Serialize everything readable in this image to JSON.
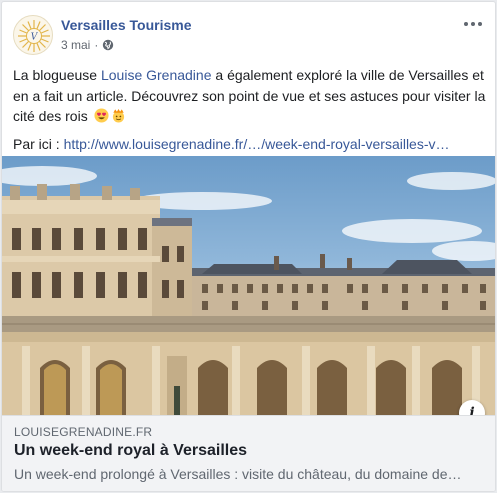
{
  "post": {
    "page_name": "Versailles Tourisme",
    "date": "3 mai",
    "separator": "·",
    "privacy_icon": "globe-icon",
    "more_icon": "more-horizontal-icon",
    "text": {
      "part1": "La blogueuse ",
      "mention": "Louise Grenadine",
      "part2": " a également exploré la ville de Versailles et en a fait un article. Découvrez son point de vue et ses astuces pour visiter la cité des rois",
      "emojis": [
        "heart-eyes-emoji",
        "crown-emoji"
      ],
      "link_prefix": "Par ici : ",
      "link_url": "http://www.louisegrenadine.fr/…/week-end-royal-versailles-v…"
    }
  },
  "image": {
    "subject": "château de Versailles façade",
    "info_label": "i"
  },
  "link_card": {
    "domain": "LOUISEGRENADINE.FR",
    "title": "Un week-end royal à Versailles",
    "description": "Un week-end prolongé à Versailles : visite du château, du domaine de…"
  },
  "colors": {
    "link": "#385898",
    "text": "#1c1e21",
    "secondary": "#606770",
    "card_bg": "#f2f3f5"
  }
}
